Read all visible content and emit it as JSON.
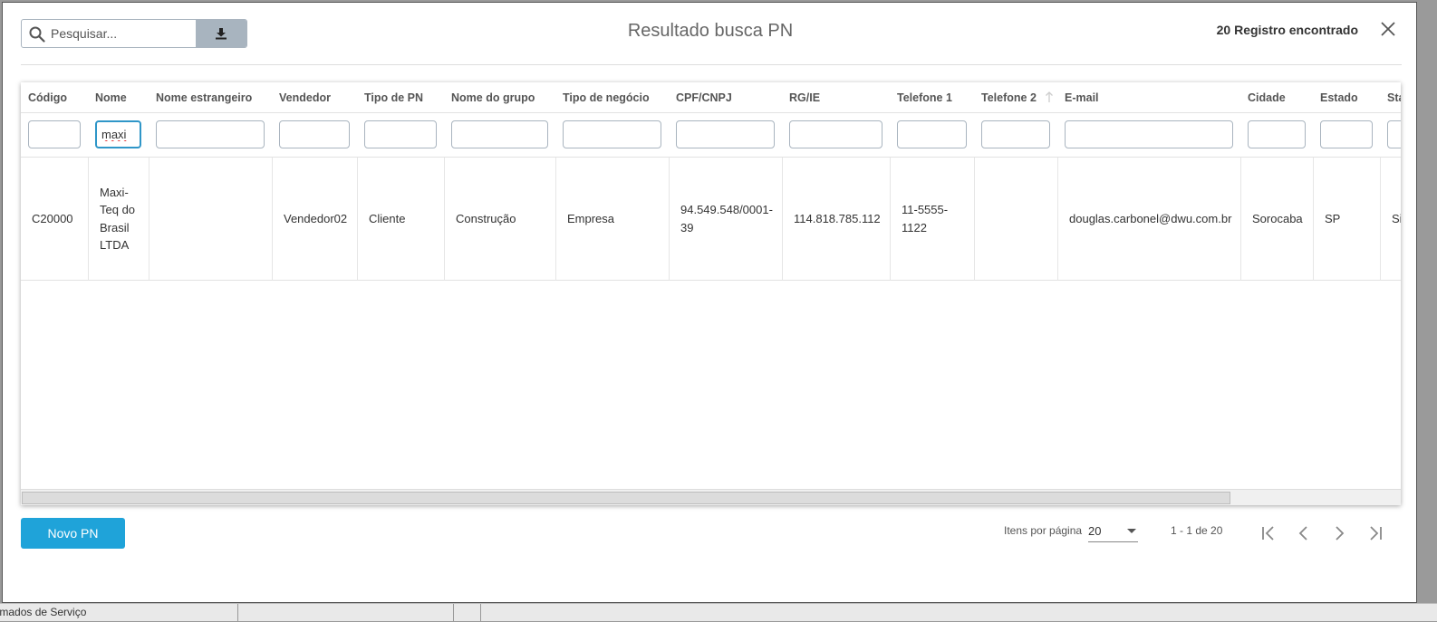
{
  "background": {
    "partial_text": "hamados de Serviço"
  },
  "header": {
    "search_placeholder": "Pesquisar...",
    "download_icon": "download-icon",
    "title": "Resultado busca PN",
    "record_count": "20 Registro encontrado",
    "close_icon": "close-icon"
  },
  "table": {
    "columns": [
      {
        "label": "Código",
        "filter": "",
        "value": "C20000"
      },
      {
        "label": "Nome",
        "filter": "maxi",
        "value": "Maxi-Teq do Brasil LTDA"
      },
      {
        "label": "Nome estrangeiro",
        "filter": "",
        "value": ""
      },
      {
        "label": "Vendedor",
        "filter": "",
        "value": "Vendedor02"
      },
      {
        "label": "Tipo de PN",
        "filter": "",
        "value": "Cliente"
      },
      {
        "label": "Nome do grupo",
        "filter": "",
        "value": "Construção"
      },
      {
        "label": "Tipo de negócio",
        "filter": "",
        "value": "Empresa"
      },
      {
        "label": "CPF/CNPJ",
        "filter": "",
        "value": "94.549.548/0001-39"
      },
      {
        "label": "RG/IE",
        "filter": "",
        "value": "114.818.785.112"
      },
      {
        "label": "Telefone 1",
        "filter": "",
        "value": "11-5555-1122"
      },
      {
        "label": "Telefone 2",
        "filter": "",
        "value": ""
      },
      {
        "label": "E-mail",
        "filter": "",
        "value": "douglas.carbonel@dwu.com.br"
      },
      {
        "label": "Cidade",
        "filter": "",
        "value": "Sorocaba"
      },
      {
        "label": "Estado",
        "filter": "",
        "value": "SP"
      },
      {
        "label": "Sta",
        "filter": "",
        "value": "Si"
      }
    ]
  },
  "footer": {
    "new_button": "Novo PN",
    "items_per_page_label": "Itens por página",
    "items_per_page_value": "20",
    "range_label": "1 - 1 de 20"
  },
  "colors": {
    "accent": "#1fa3d9",
    "download_bg": "#a8b4bf",
    "focus": "#2f96c8"
  }
}
